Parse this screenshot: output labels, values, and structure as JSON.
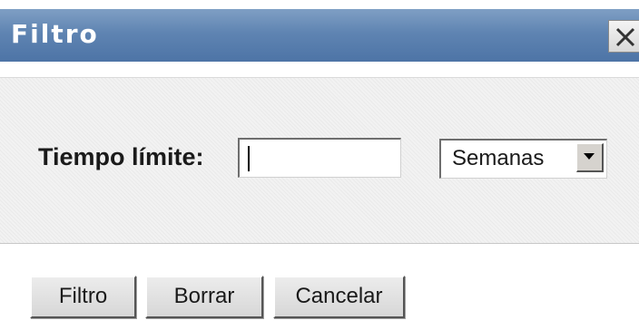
{
  "dialog": {
    "title": "Filtro",
    "close_icon": "close-icon"
  },
  "form": {
    "time_limit_label": "Tiempo límite:",
    "time_limit_value": "",
    "unit_selected": "Semanas",
    "unit_arrow_icon": "chevron-down-icon"
  },
  "buttons": {
    "filter_label": "Filtro",
    "clear_label": "Borrar",
    "cancel_label": "Cancelar"
  },
  "colors": {
    "titlebar": "#5f84b2",
    "title_text": "#ffffff",
    "content_bg": "#f2f2f2",
    "button_bg": "#e0e0e0"
  }
}
